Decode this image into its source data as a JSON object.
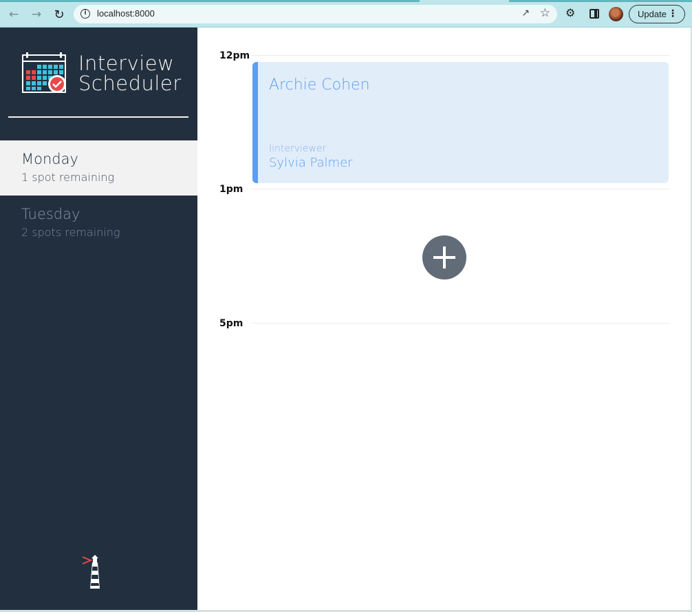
{
  "browser": {
    "url": "localhost:8000",
    "update_label": "Update",
    "icons": {
      "back": "arrow-left-icon",
      "forward": "arrow-right-icon",
      "reload": "reload-icon",
      "site_info": "info-icon",
      "share": "share-icon",
      "bookmark": "star-icon",
      "extensions": "puzzle-icon",
      "side_panel": "side-panel-icon",
      "menu": "kebab-menu-icon"
    },
    "accent": "#bfe6ea"
  },
  "sidebar": {
    "title_line1": "Interview",
    "title_line2": "Scheduler",
    "background": "#222f3e",
    "days": [
      {
        "name": "Monday",
        "spots": "1 spot remaining",
        "selected": true
      },
      {
        "name": "Tuesday",
        "spots": "2 spots remaining",
        "selected": false
      }
    ],
    "logo_icon": "calendar-icon",
    "footer_icon": "lighthouse-icon"
  },
  "schedule": {
    "hours": [
      "12pm",
      "1pm",
      "5pm"
    ],
    "appointment": {
      "student": "Archie Cohen",
      "interviewer_label": "Iinterviewer",
      "interviewer": "Sylvia Palmer",
      "accent": "#5b9ef2",
      "background": "#e2edfa"
    },
    "add_icon": "plus-icon"
  }
}
